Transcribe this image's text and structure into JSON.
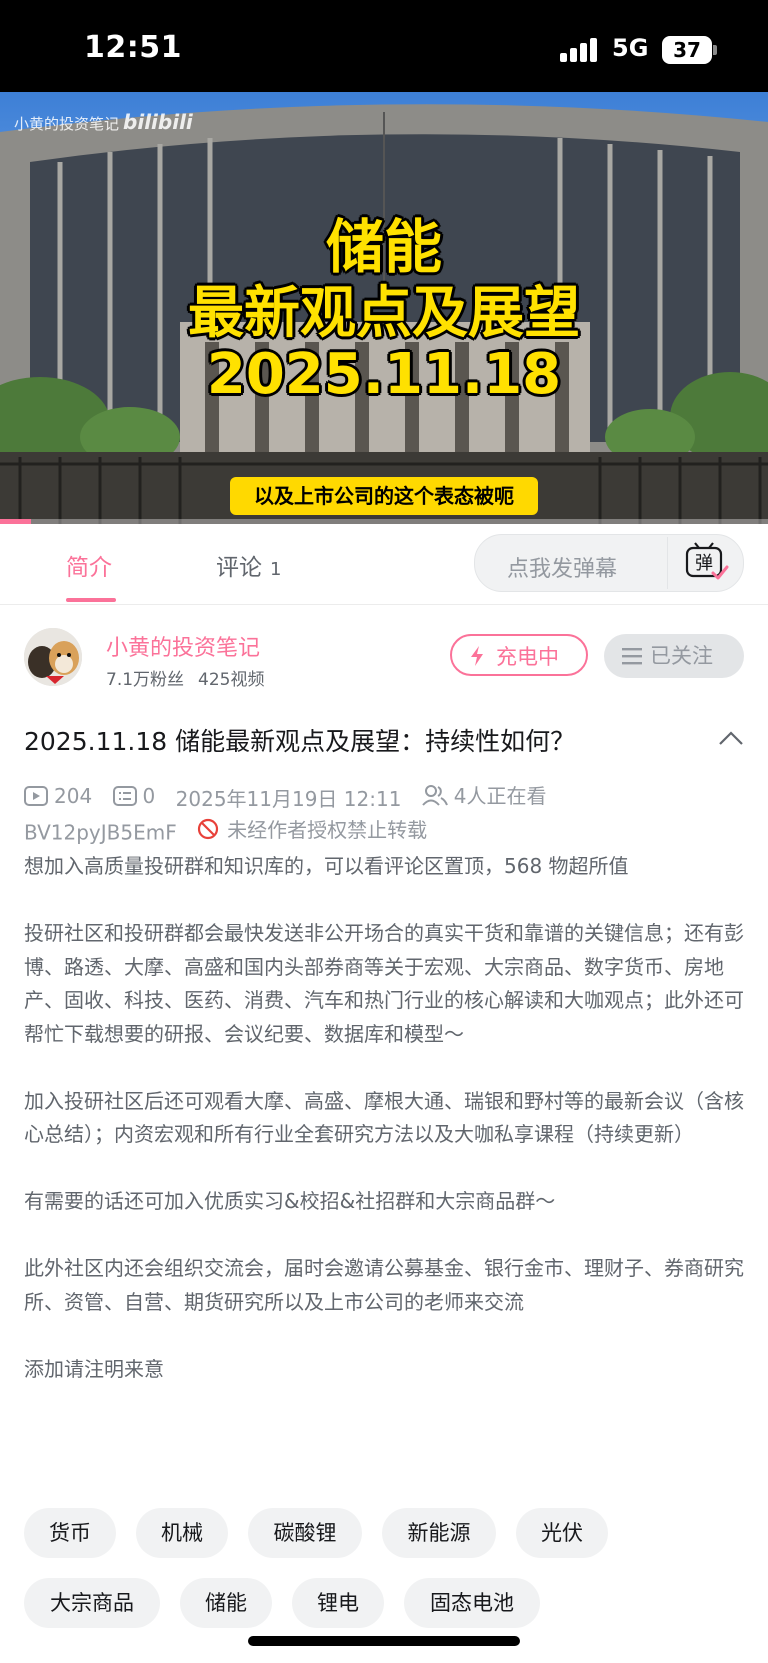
{
  "status_bar": {
    "time": "12:51",
    "network": "5G",
    "battery": "37"
  },
  "video": {
    "watermark_author": "小黄的投资笔记",
    "watermark_logo": "bilibili",
    "title_line1": "储能",
    "title_line2": "最新观点及展望",
    "title_line3": "2025.11.18",
    "banner": "以及上市公司的这个表态被呃",
    "progress_fraction": 0.04,
    "colors": {
      "title_yellow": "#ffe100",
      "banner_yellow": "#ffd900"
    }
  },
  "tabs": {
    "intro_label": "简介",
    "comments_label": "评论",
    "comments_count": "1",
    "danmaku_placeholder": "点我发弹幕",
    "danmaku_button_char": "弹",
    "accent": "#fb7299"
  },
  "author": {
    "name": "小黄的投资笔记",
    "fans": "7.1万粉丝",
    "videos": "425视频",
    "charge_label": "充电中",
    "follow_label": "已关注"
  },
  "video_info": {
    "title": "2025.11.18 储能最新观点及展望：持续性如何？",
    "plays": "204",
    "danmaku_count": "0",
    "publish_time": "2025年11月19日 12:11",
    "watching": "4人正在看",
    "bvid": "BV12pyJB5EmF",
    "copyright": "未经作者授权禁止转载"
  },
  "description": {
    "p1": "想加入高质量投研群和知识库的，可以看评论区置顶，568 物超所值",
    "p2": "投研社区和投研群都会最快发送非公开场合的真实干货和靠谱的关键信息；还有彭博、路透、大摩、高盛和国内头部券商等关于宏观、大宗商品、数字货币、房地产、固收、科技、医药、消费、汽车和热门行业的核心解读和大咖观点；此外还可帮忙下载想要的研报、会议纪要、数据库和模型～",
    "p3": "加入投研社区后还可观看大摩、高盛、摩根大通、瑞银和野村等的最新会议（含核心总结）；内资宏观和所有行业全套研究方法以及大咖私享课程（持续更新）",
    "p4": "有需要的话还可加入优质实习&校招&社招群和大宗商品群～",
    "p5": "此外社区内还会组织交流会，届时会邀请公募基金、银行金市、理财子、券商研究所、资管、自营、期货研究所以及上市公司的老师来交流",
    "p6": "添加请注明来意"
  },
  "tags": [
    "货币",
    "机械",
    "碳酸锂",
    "新能源",
    "光伏",
    "大宗商品",
    "储能",
    "锂电",
    "固态电池"
  ]
}
